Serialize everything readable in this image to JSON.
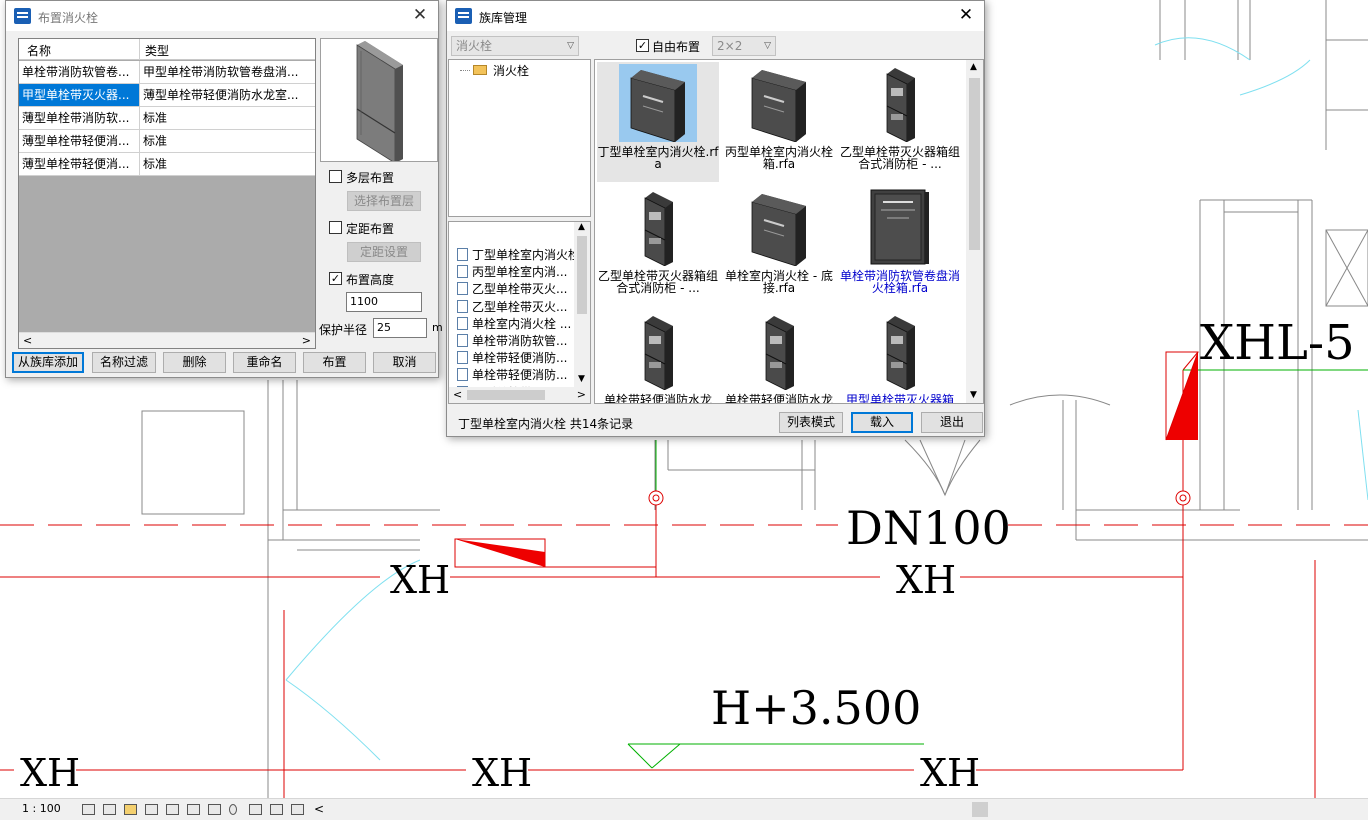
{
  "cad": {
    "labels": {
      "xhl": "XHL-5",
      "dn": "DN100",
      "xh_mid_left": "XH",
      "xh_mid_right": "XH",
      "elevation": "H+3.500",
      "xh_bottom_1": "XH",
      "xh_bottom_2": "XH",
      "xh_bottom_3": "XH"
    },
    "colors": {
      "pipe": "#dd0000",
      "wall": "#888888",
      "green": "#00b000",
      "cyan": "#7fe0f0"
    }
  },
  "place_dialog": {
    "title": "布置消火栓",
    "close": "✕",
    "columns": {
      "name": "名称",
      "type": "类型"
    },
    "rows": [
      {
        "name": "单栓带消防软管卷...",
        "type": "甲型单栓带消防软管卷盘消...",
        "selected": false
      },
      {
        "name": "甲型单栓带灭火器...",
        "type": "薄型单栓带轻便消防水龙室...",
        "selected": true
      },
      {
        "name": "薄型单栓带消防软...",
        "type": "标准",
        "selected": false
      },
      {
        "name": "薄型单栓带轻便消...",
        "type": "标准",
        "selected": false
      },
      {
        "name": "薄型单栓带轻便消...",
        "type": "标准",
        "selected": false
      }
    ],
    "multi_layer": {
      "label": "多层布置",
      "checked": false,
      "button": "选择布置层"
    },
    "fixed_spacing": {
      "label": "定距布置",
      "checked": false,
      "button": "定距设置"
    },
    "height": {
      "label": "布置高度",
      "checked": true,
      "value": "1100"
    },
    "radius": {
      "label": "保护半径",
      "value": "25",
      "unit": "m"
    },
    "buttons": {
      "add_from_library": "从族库添加",
      "filter": "名称过滤",
      "delete": "删除",
      "rename": "重命名",
      "place": "布置",
      "cancel": "取消"
    }
  },
  "family_manager": {
    "title": "族库管理",
    "close": "✕",
    "category_combo": "消火栓",
    "free_layout": {
      "label": "自由布置",
      "checked": true
    },
    "grid_combo": "2×2",
    "tree_folder": "消火栓",
    "files": [
      "丁型单栓室内消火栓",
      "丙型单栓室内消...",
      "乙型单栓带灭火...",
      "乙型单栓带灭火...",
      "单栓室内消火栓 ...",
      "单栓带消防软管...",
      "单栓带轻便消防...",
      "单栓带轻便消防...",
      "甲型单栓带灭火"
    ],
    "tiles": [
      {
        "caption": "丁型单栓室内消火栓.rfa",
        "style": "box",
        "selected": true,
        "highlight": false
      },
      {
        "caption": "丙型单栓室内消火栓箱.rfa",
        "style": "box",
        "selected": false,
        "highlight": false
      },
      {
        "caption": "乙型单栓带灭火器箱组合式消防柜 - ...",
        "style": "tall",
        "selected": false,
        "highlight": false
      },
      {
        "caption": "乙型单栓带灭火器箱组合式消防柜 - ...",
        "style": "tall",
        "selected": false,
        "highlight": false
      },
      {
        "caption": "单栓室内消火栓 - 底接.rfa",
        "style": "box",
        "selected": false,
        "highlight": false
      },
      {
        "caption": "单栓带消防软管卷盘消火栓箱.rfa",
        "style": "flat",
        "selected": false,
        "highlight": true
      },
      {
        "caption": "单栓带轻便消防水龙",
        "style": "tall",
        "selected": false,
        "highlight": false
      },
      {
        "caption": "单栓带轻便消防水龙",
        "style": "tall",
        "selected": false,
        "highlight": false
      },
      {
        "caption": "甲型单栓带灭火器箱",
        "style": "tall",
        "selected": false,
        "highlight": true
      }
    ],
    "status_text": "丁型单栓室内消火栓   共14条记录",
    "buttons": {
      "list_mode": "列表模式",
      "load": "载入",
      "exit": "退出"
    }
  },
  "statusbar": {
    "scale": "1 : 100"
  }
}
